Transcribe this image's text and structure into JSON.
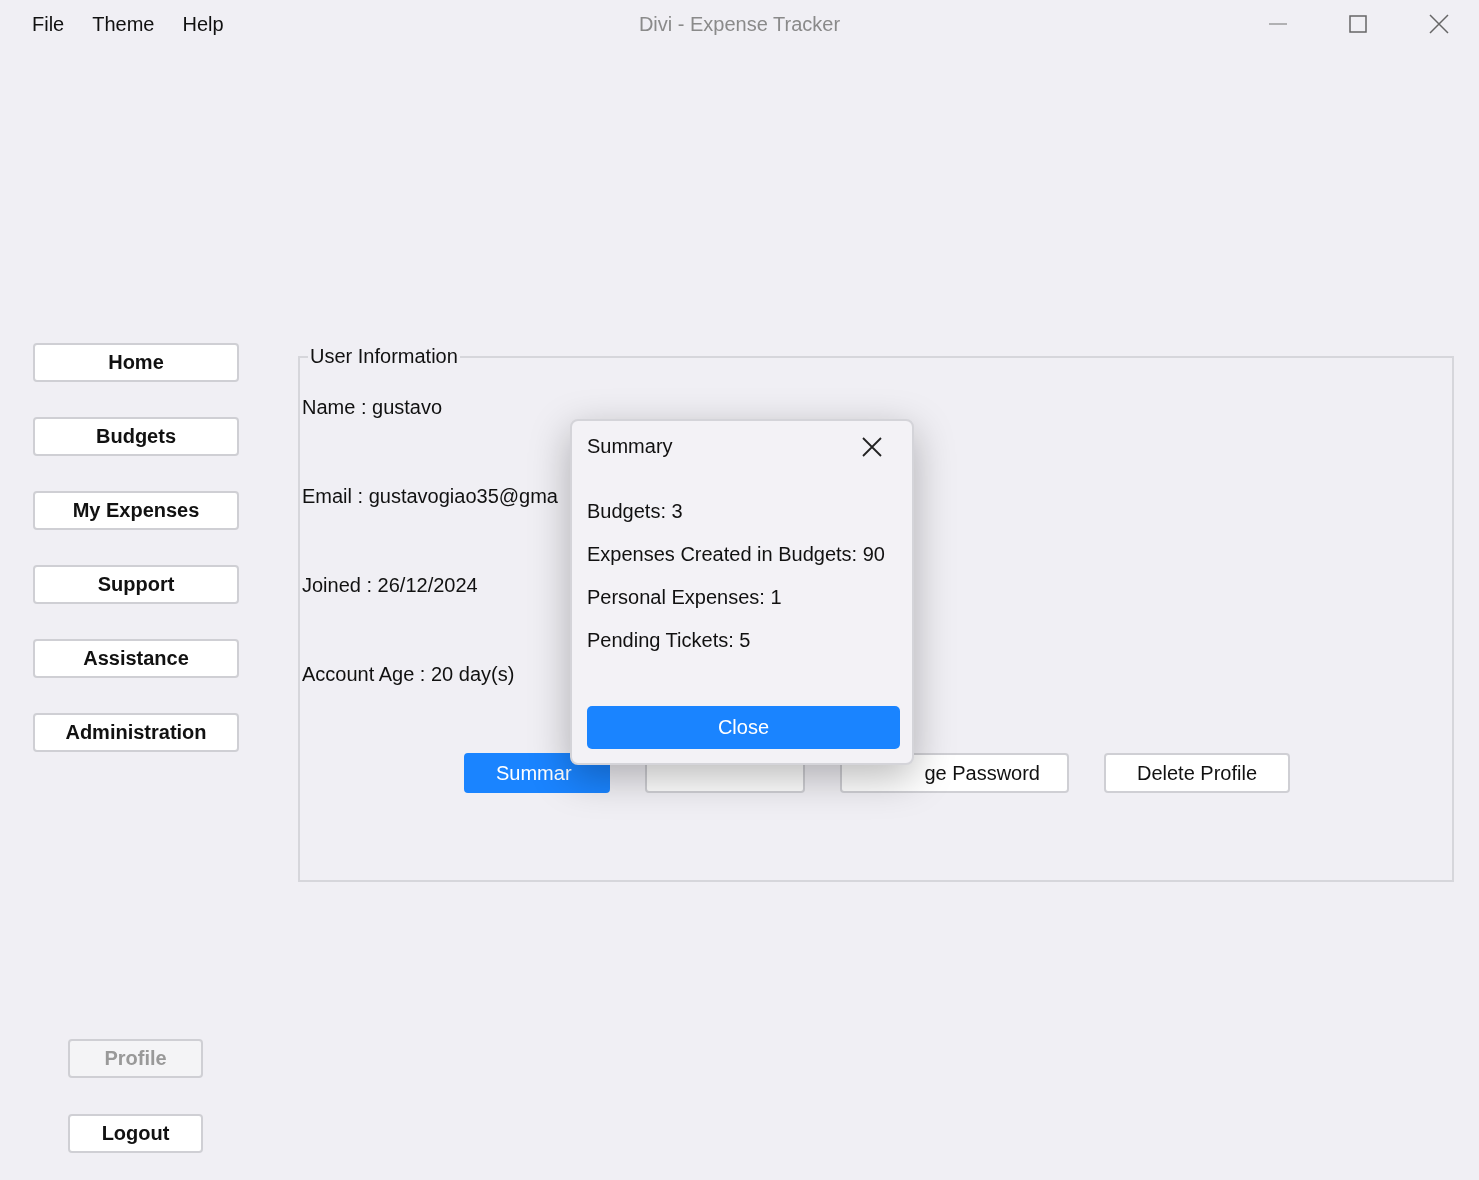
{
  "window": {
    "title": "Divi - Expense Tracker"
  },
  "menu": [
    "File",
    "Theme",
    "Help"
  ],
  "sidebar": {
    "items": [
      {
        "label": "Home",
        "disabled": false
      },
      {
        "label": "Budgets",
        "disabled": false
      },
      {
        "label": "My Expenses",
        "disabled": false
      },
      {
        "label": "Support",
        "disabled": false
      },
      {
        "label": "Assistance",
        "disabled": false
      },
      {
        "label": "Administration",
        "disabled": false
      }
    ],
    "bottom_items": [
      {
        "label": "Profile",
        "disabled": true
      },
      {
        "label": "Logout",
        "disabled": false
      }
    ]
  },
  "user_info": {
    "title": "User Information",
    "fields": [
      "Name : gustavo",
      "Email : gustavogiao35@gma",
      "Joined : 26/12/2024",
      "Account Age : 20 day(s)"
    ]
  },
  "actions": [
    {
      "label": "Summar",
      "kind": "primary"
    },
    {
      "kind": "default"
    },
    {
      "label": "ge Password",
      "kind": "default"
    },
    {
      "label": "Delete Profile",
      "kind": "default"
    }
  ],
  "dialog": {
    "title": "Summary",
    "lines": [
      "Budgets: 3",
      "Expenses Created in Budgets: 90",
      "Personal Expenses: 1",
      "Pending Tickets: 5"
    ],
    "button": "Close"
  }
}
